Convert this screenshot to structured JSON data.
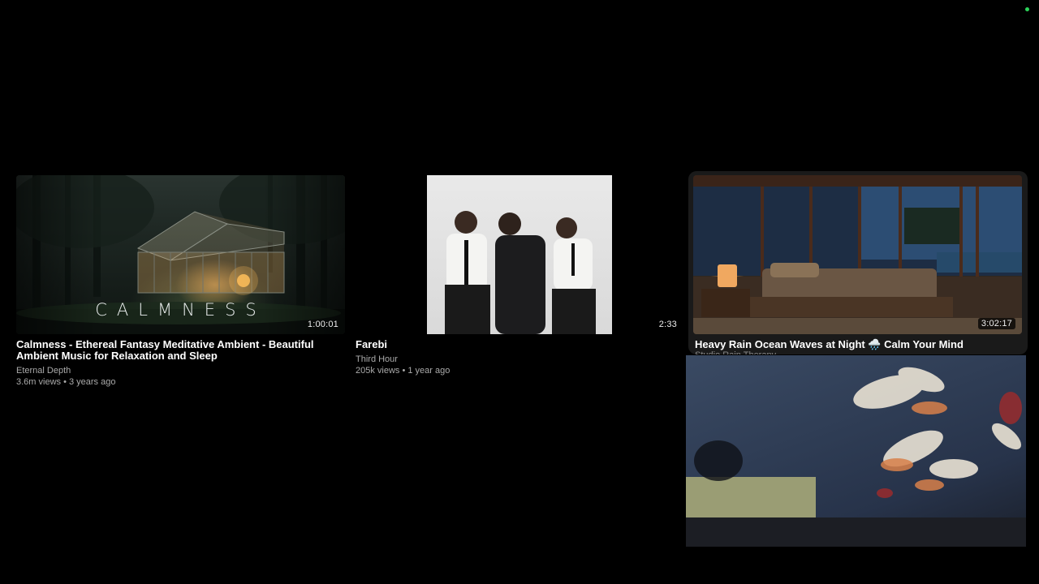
{
  "videos": [
    {
      "thumbnail_text": "CALMNESS",
      "duration": "1:00:01",
      "title": "Calmness - Ethereal Fantasy Meditative Ambient - Beautiful Ambient Music for Relaxation and Sleep",
      "channel": "Eternal Depth",
      "stats": "3.6m views • 3 years ago"
    },
    {
      "duration": "2:33",
      "title": "Farebi",
      "channel": "Third Hour",
      "stats": "205k views • 1 year ago"
    },
    {
      "duration": "3:02:17",
      "title": "Heavy Rain Ocean Waves at Night 🌧️ Calm Your Mind",
      "channel_partial": "Studio Rain Therapy"
    }
  ],
  "colors": {
    "background": "#000000",
    "status_dot": "#2bd45a",
    "meta_text": "#aaaaaa"
  }
}
